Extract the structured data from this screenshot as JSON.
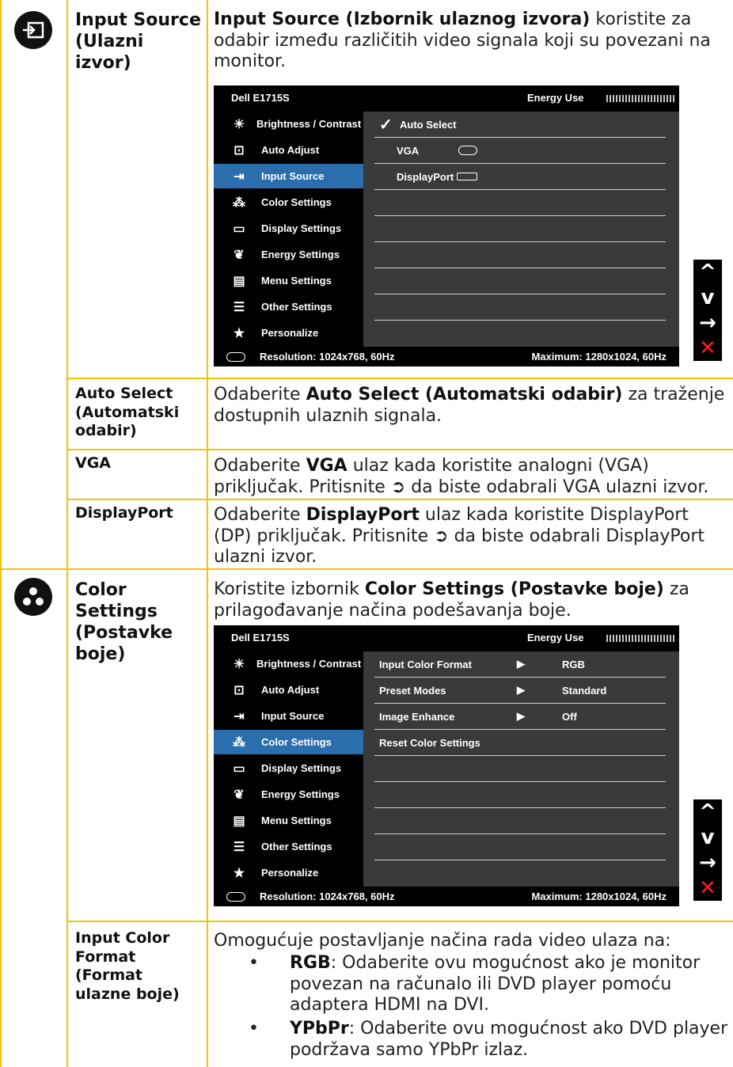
{
  "section_input": {
    "label": "Input Source (Ulazni izvor)",
    "intro_bold": "Input Source (Izbornik ulaznog izvora)",
    "intro_rest": " koristite za odabir između različitih video signala koji su povezani na monitor.",
    "osd": {
      "title": "Dell E1715S",
      "energy": "Energy Use",
      "menu": [
        "Brightness / Contrast",
        "Auto Adjust",
        "Input Source",
        "Color Settings",
        "Display Settings",
        "Energy Settings",
        "Menu Settings",
        "Other Settings",
        "Personalize"
      ],
      "options": [
        "Auto Select",
        "VGA",
        "DisplayPort"
      ],
      "resolution": "Resolution: 1024x768, 60Hz",
      "maximum": "Maximum: 1280x1024, 60Hz"
    },
    "rows": [
      {
        "label": "Auto Select (Automatski odabir)",
        "pre": "Odaberite ",
        "bold": "Auto Select (Automatski odabir)",
        "post": " za traženje dostupnih ulaznih signala."
      },
      {
        "label": "VGA",
        "pre": "Odaberite ",
        "bold": "VGA",
        "post": " ulaz kada koristite analogni (VGA) priključak. Pritisnite ",
        "post2": " da biste odabrali VGA ulazni izvor."
      },
      {
        "label": "DisplayPort",
        "pre": "Odaberite ",
        "bold": "DisplayPort",
        "post": " ulaz kada koristite DisplayPort (DP) priključak. Pritisnite ",
        "post2": " da biste odabrali DisplayPort ulazni izvor."
      }
    ]
  },
  "section_color": {
    "label": "Color Settings (Postavke boje)",
    "intro_pre": "Koristite izbornik ",
    "intro_bold": "Color Settings (Postavke boje)",
    "intro_rest": " za prilagođavanje načina podešavanja boje.",
    "osd": {
      "title": "Dell E1715S",
      "energy": "Energy Use",
      "menu": [
        "Brightness / Contrast",
        "Auto Adjust",
        "Input Source",
        "Color Settings",
        "Display Settings",
        "Energy Settings",
        "Menu Settings",
        "Other Settings",
        "Personalize"
      ],
      "options": [
        {
          "name": "Input Color Format",
          "value": "RGB"
        },
        {
          "name": "Preset Modes",
          "value": "Standard"
        },
        {
          "name": "Image Enhance",
          "value": "Off"
        },
        {
          "name": "Reset Color Settings",
          "value": ""
        }
      ],
      "resolution": "Resolution: 1024x768, 60Hz",
      "maximum": "Maximum: 1280x1024, 60Hz"
    },
    "icf": {
      "label": "Input Color Format (Format ulazne boje)",
      "intro": "Omogućuje postavljanje načina rada video ulaza na:",
      "b1_bold": "RGB",
      "b1_rest": ": Odaberite ovu mogućnost ako je monitor povezan na računalo ili DVD player pomoću adaptera HDMI na DVI.",
      "b2_bold": "YPbPr",
      "b2_rest": ": Odaberite ovu mogućnost ako DVD player podržava samo YPbPr izlaz."
    }
  },
  "nav": {
    "up": "^",
    "down": "v",
    "enter": "→",
    "exit": "✕"
  },
  "colors": {
    "rule": "#f4c400",
    "highlight": "#2b6ead"
  }
}
